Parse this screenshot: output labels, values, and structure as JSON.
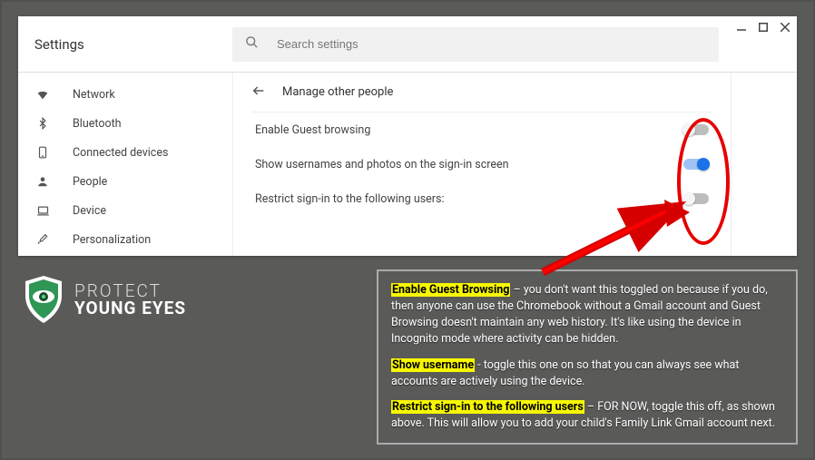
{
  "page_title": "Settings",
  "search": {
    "placeholder": "Search settings"
  },
  "sidebar": {
    "items": [
      {
        "label": "Network"
      },
      {
        "label": "Bluetooth"
      },
      {
        "label": "Connected devices"
      },
      {
        "label": "People"
      },
      {
        "label": "Device"
      },
      {
        "label": "Personalization"
      }
    ]
  },
  "panel": {
    "title": "Manage other people",
    "rows": [
      {
        "label": "Enable Guest browsing",
        "on": false
      },
      {
        "label": "Show usernames and photos on the sign-in screen",
        "on": true
      },
      {
        "label": "Restrict sign-in to the following users:",
        "on": false
      }
    ]
  },
  "logo": {
    "line1": "PROTECT",
    "line2": "YOUNG EYES"
  },
  "info": {
    "p1a": "Enable Guest Browsing",
    "p1b": " – you don't want this toggled on because if you do, then anyone can use the Chromebook without a Gmail account and Guest Browsing doesn't maintain any web history. It's like using the device in Incognito mode where activity can be hidden.",
    "p2a": "Show username",
    "p2b": " - toggle this one on so that you can always see what accounts are actively using the device.",
    "p3a": "Restrict sign-in to the following users",
    "p3b": " – FOR NOW, toggle this off, as shown above. This will allow you to add your child's Family Link Gmail account next."
  }
}
